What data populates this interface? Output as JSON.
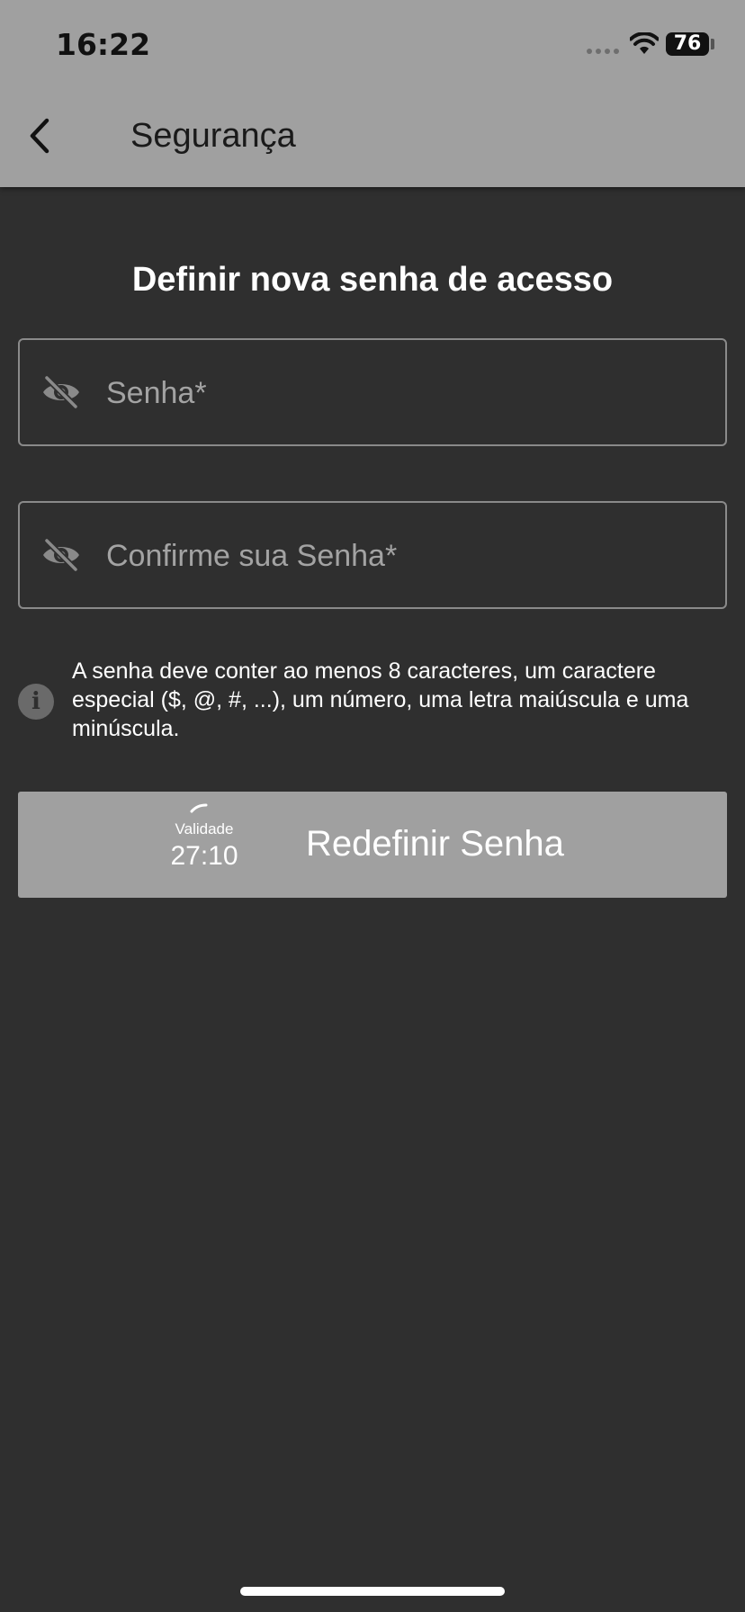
{
  "status_bar": {
    "time": "16:22",
    "battery": "76"
  },
  "nav": {
    "title": "Segurança"
  },
  "form": {
    "heading": "Definir nova senha de acesso",
    "password_placeholder": "Senha*",
    "confirm_placeholder": "Confirme sua Senha*",
    "hint": "A senha deve conter ao menos 8 caracteres, um caractere especial ($, @, #, ...), um número, uma letra maiúscula e uma minúscula."
  },
  "action": {
    "validity_label": "Validade",
    "validity_time": "27:10",
    "label": "Redefinir Senha"
  },
  "icons": {
    "back": "chevron-left-icon",
    "password_visibility": "eye-off-icon",
    "info": "info-icon"
  },
  "colors": {
    "background": "#2f2f2f",
    "header": "#a0a0a0",
    "button": "#a0a0a0"
  }
}
